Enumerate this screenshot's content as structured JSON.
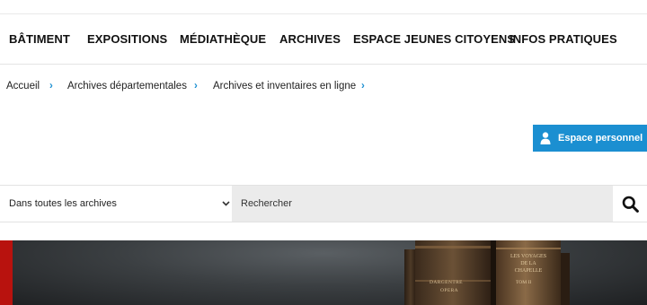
{
  "nav": {
    "items": [
      "BÂTIMENT",
      "EXPOSITIONS",
      "MÉDIATHÈQUE",
      "ARCHIVES",
      "ESPACE JEUNES CITOYENS",
      "INFOS PRATIQUES"
    ]
  },
  "breadcrumb": {
    "items": [
      "Accueil",
      "Archives départementales",
      "Archives et inventaires en ligne"
    ],
    "separator": "›"
  },
  "account": {
    "label": "Espace personnel",
    "icon": "user-icon"
  },
  "search": {
    "scope_value": "Dans toutes les archives",
    "placeholder": "Rechercher",
    "button_icon": "search-icon"
  },
  "hero": {
    "book_labels": [
      "DARGENTRE",
      "OPERA",
      "LES VOYAGES DE LA CHAPELLE",
      "TOM II"
    ]
  },
  "colors": {
    "accent": "#1b8fd1",
    "search_field_bg": "#ebebeb",
    "hero_dark": "#2b2e30",
    "hero_red_edge": "#b8120e"
  }
}
